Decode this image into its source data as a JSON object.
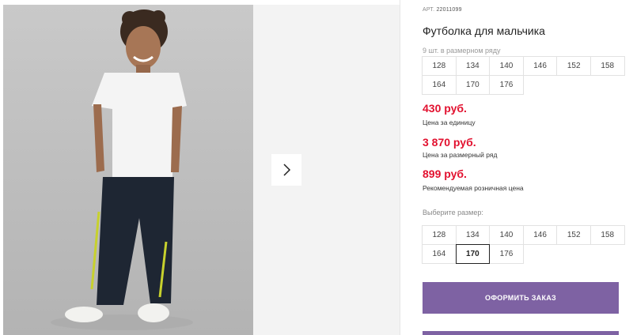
{
  "product": {
    "article_label": "АРТ.",
    "article_number": "22011099",
    "title": "Футболка для мальчика",
    "set_note": "9 шт. в размерном ряду"
  },
  "size_row": [
    "128",
    "134",
    "140",
    "146",
    "152",
    "158",
    "164",
    "170",
    "176"
  ],
  "prices": {
    "unit_price": "430 руб.",
    "unit_label": "Цена за единицу",
    "set_price": "3 870 руб.",
    "set_label": "Цена за размерный ряд",
    "retail_price": "899 руб.",
    "retail_label": "Рекомендуемая розничная цена"
  },
  "size_picker": {
    "label": "Выберите размер:",
    "options": [
      "128",
      "134",
      "140",
      "146",
      "152",
      "158",
      "164",
      "170",
      "176"
    ],
    "selected": "170"
  },
  "actions": {
    "order_label": "ОФОРМИТЬ ЗАКАЗ"
  },
  "colors": {
    "price": "#e2112f",
    "accent": "#7e62a3"
  }
}
